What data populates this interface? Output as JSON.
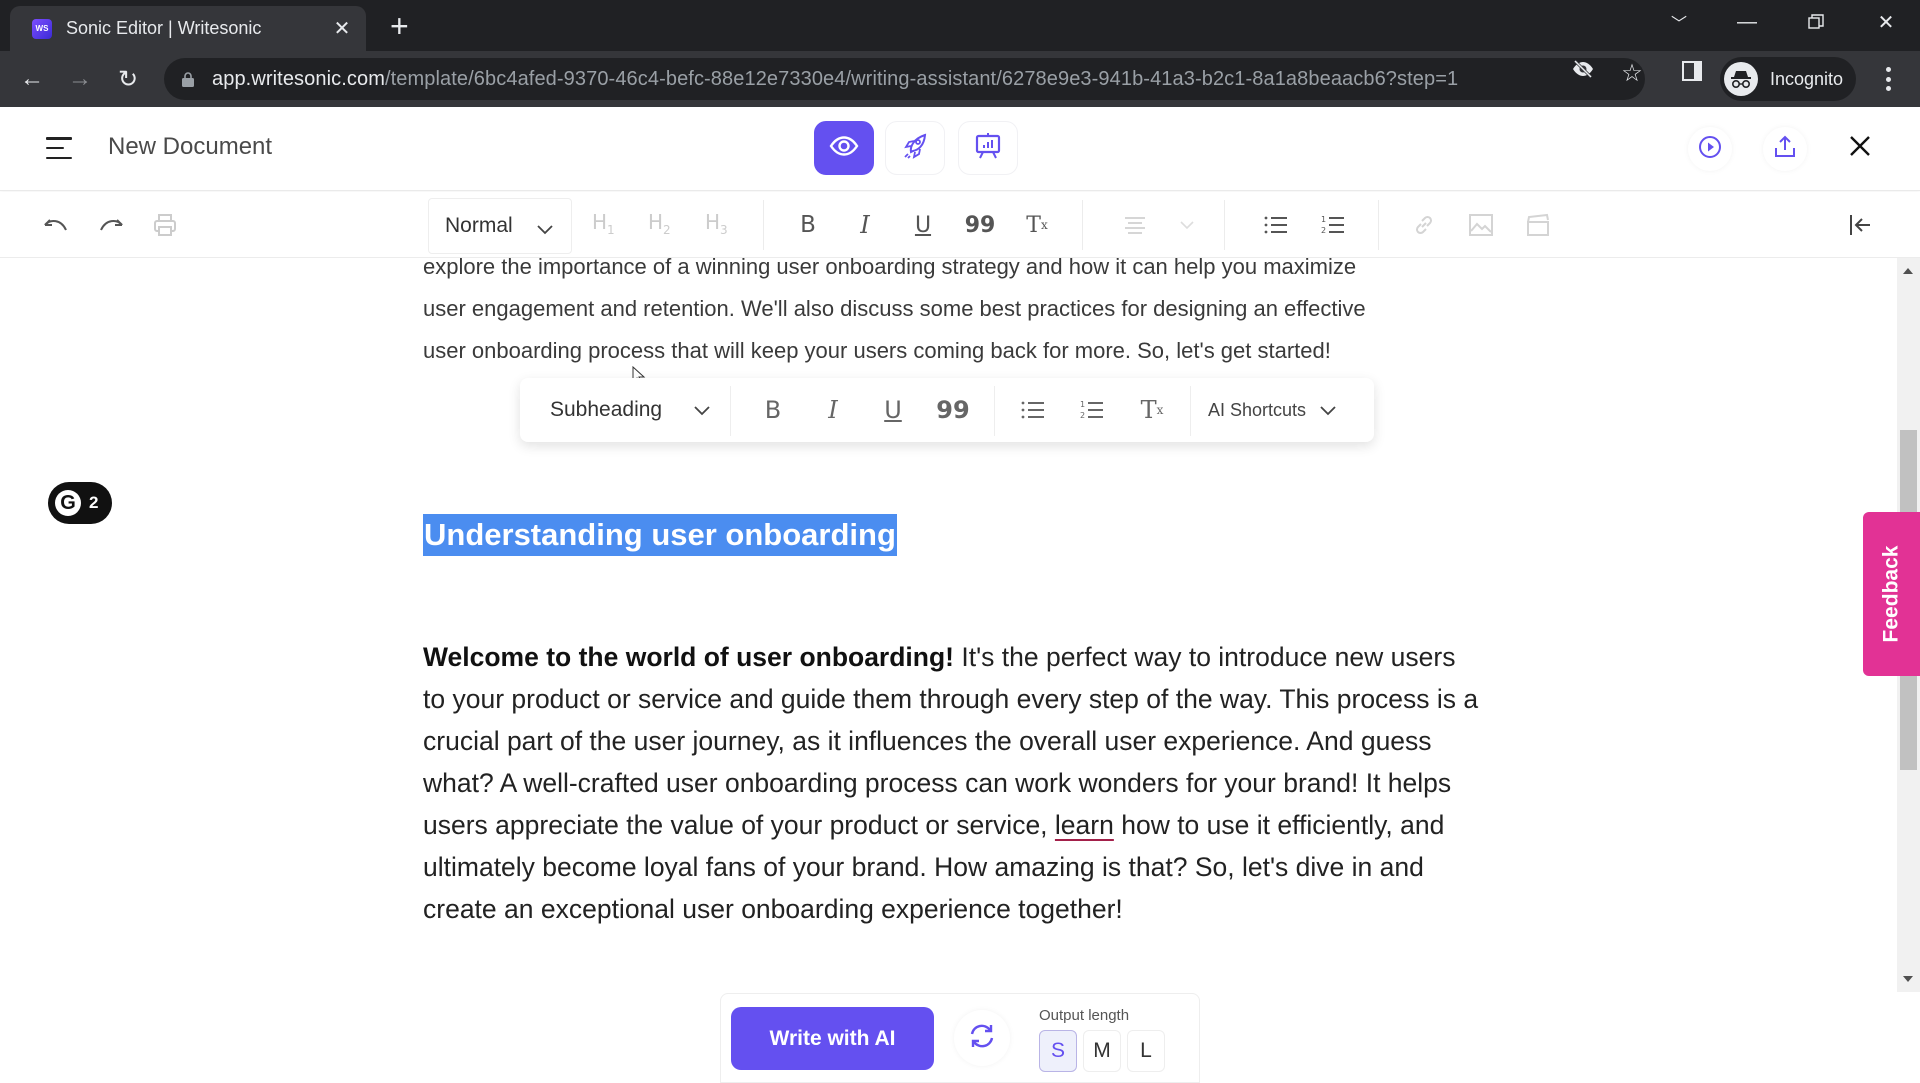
{
  "browser": {
    "tab_title": "Sonic Editor | Writesonic",
    "favicon_text": "WS",
    "url_host": "app.writesonic.com",
    "url_path": "/template/6bc4afed-9370-46c4-befc-88e12e7330e4/writing-assistant/6278e9e3-941b-41a3-b2c1-8a1a8beaacb6?step=1",
    "profile_label": "Incognito"
  },
  "header": {
    "doc_title": "New Document",
    "modes": [
      "preview",
      "launch",
      "presentation"
    ],
    "accent": "#6450f0"
  },
  "toolbar": {
    "style_value": "Normal",
    "headings": [
      "H1",
      "H2",
      "H3"
    ]
  },
  "content": {
    "top_para": "explore the importance of a winning user onboarding strategy and how it can help you maximize user engagement and retention. We'll also discuss some best practices for designing an effective user onboarding process that will keep your users coming back for more. So, let's get started!",
    "top_lines": [
      "explore the importance of a winning user onboarding strategy and how it can help you maximize",
      "user engagement and retention. We'll also discuss some best practices for designing an effective",
      "user onboarding process that will keep your users coming back for more. So, let's get started!"
    ],
    "heading": "Understanding user onboarding",
    "body_bold": "Welcome to the world of user onboarding!",
    "body_part1": " It's the perfect way to introduce new users to your product or service and guide them through every step of the way. This process is a crucial part of the user journey, as it influences the overall user experience. And guess what? A well-crafted user onboarding process can work wonders for your brand! It helps users appreciate the value of your product or service, ",
    "body_spell": "learn",
    "body_part2": " how to use it efficiently, and ultimately become loyal fans of your brand. How amazing is that? So, let's dive in and create an exceptional user onboarding experience together!"
  },
  "float_bar": {
    "style_value": "Subheading",
    "ai_shortcuts": "AI Shortcuts"
  },
  "grammarly": {
    "letter": "G",
    "count": "2"
  },
  "feedback": "Feedback",
  "ai_panel": {
    "write_label": "Write with AI",
    "output_label": "Output length",
    "lengths": [
      "S",
      "M",
      "L"
    ],
    "selected_length": "S"
  }
}
